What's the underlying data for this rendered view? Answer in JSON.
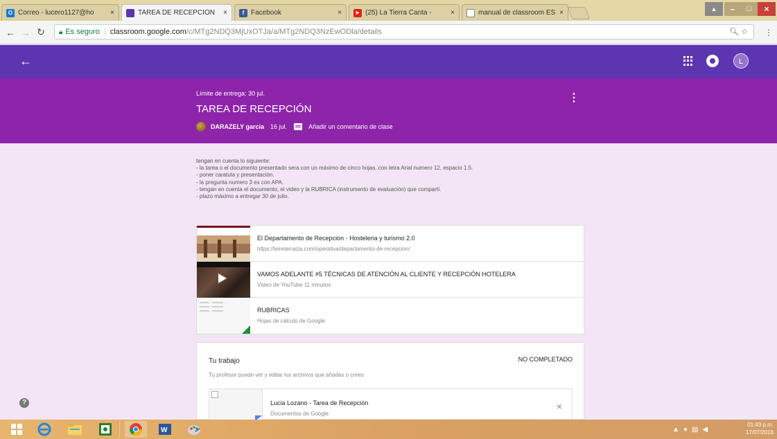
{
  "browser": {
    "tabs": [
      {
        "label": "Correo - lucero1127@ho",
        "favicon_color": "#1976d2",
        "favicon_glyph": "O",
        "active": false
      },
      {
        "label": "TAREA DE RECEPCIÓN",
        "favicon_color": "#5e35b1",
        "favicon_glyph": "",
        "active": true
      },
      {
        "label": "Facebook",
        "favicon_color": "#3b5998",
        "favicon_glyph": "f",
        "active": false
      },
      {
        "label": "(25) La Tierra Canta -",
        "favicon_color": "#e62117",
        "favicon_glyph": "▶",
        "active": false
      },
      {
        "label": "manual de classroom ES",
        "favicon_color": "#ffffff",
        "favicon_glyph": "",
        "active": false
      }
    ],
    "tab_close_glyph": "×",
    "security_label": "Es seguro",
    "url_host": "classroom.google.com",
    "url_path": "/c/MTg2NDQ3MjUxOTJa/a/MTg2NDQ3NzEwODla/details",
    "window_buttons": {
      "user": "▲",
      "minimize": "–",
      "maximize": "□",
      "close": "×"
    }
  },
  "appbar": {
    "back_glyph": "←",
    "avatar_initial": "L",
    "color": "#5e35b1"
  },
  "assignment": {
    "due": "Límite de entrega: 30 jul.",
    "title": "TAREA DE RECEPCIÓN",
    "author": "DARAZELY garcia",
    "posted_date": "16 jul.",
    "comment_link": "Añadir un comentario de clase",
    "more_glyph": "⋮",
    "color": "#8e24aa"
  },
  "description": [
    "tengan en cuenta lo siguiente:",
    "- la tarea o el documento presentado sera con un máximo de cinco hojas, con letra Arial numero 12, espacio 1.5.",
    "- poner caratula y presentación.",
    "- la pregunta numero 3 es con APA.",
    "- tengan en cuenta el documento, el video y la RUBRICA (instrumento de evaluación) que compartí.",
    "- plazo máximo a entregar 30 de julio."
  ],
  "attachments": [
    {
      "title": "El Departamento de Recepcion - Hosteleria y turismo 2.0",
      "subtitle": "https://leirelarraiza.com/operativa/departamento-de-recepcion/",
      "kind": "web"
    },
    {
      "title": "VAMOS ADELANTE #5 TÉCNICAS DE ATENCIÓN AL CLIENTE Y RECEPCIÓN HOTELERA",
      "subtitle": "Vídeo de YouTube   11 minutos",
      "kind": "video"
    },
    {
      "title": "RUBRICAS",
      "subtitle": "Hojas de cálculo de Google",
      "kind": "sheet"
    }
  ],
  "work": {
    "title": "Tu trabajo",
    "status": "NO COMPLETADO",
    "help": "Tu profesor puede ver y editar los archivos que añadas o crees",
    "file_title": "Lucia Lozano - Tarea de Recepción",
    "file_type": "Documentos de Google",
    "remove_glyph": "×"
  },
  "help_glyph": "?",
  "taskbar": {
    "clock_time": "01:43 p.m.",
    "clock_date": "17/07/2018",
    "apps": [
      "windows-start",
      "internet-explorer",
      "file-explorer",
      "google-classroom",
      "chrome",
      "word",
      "paint"
    ]
  }
}
